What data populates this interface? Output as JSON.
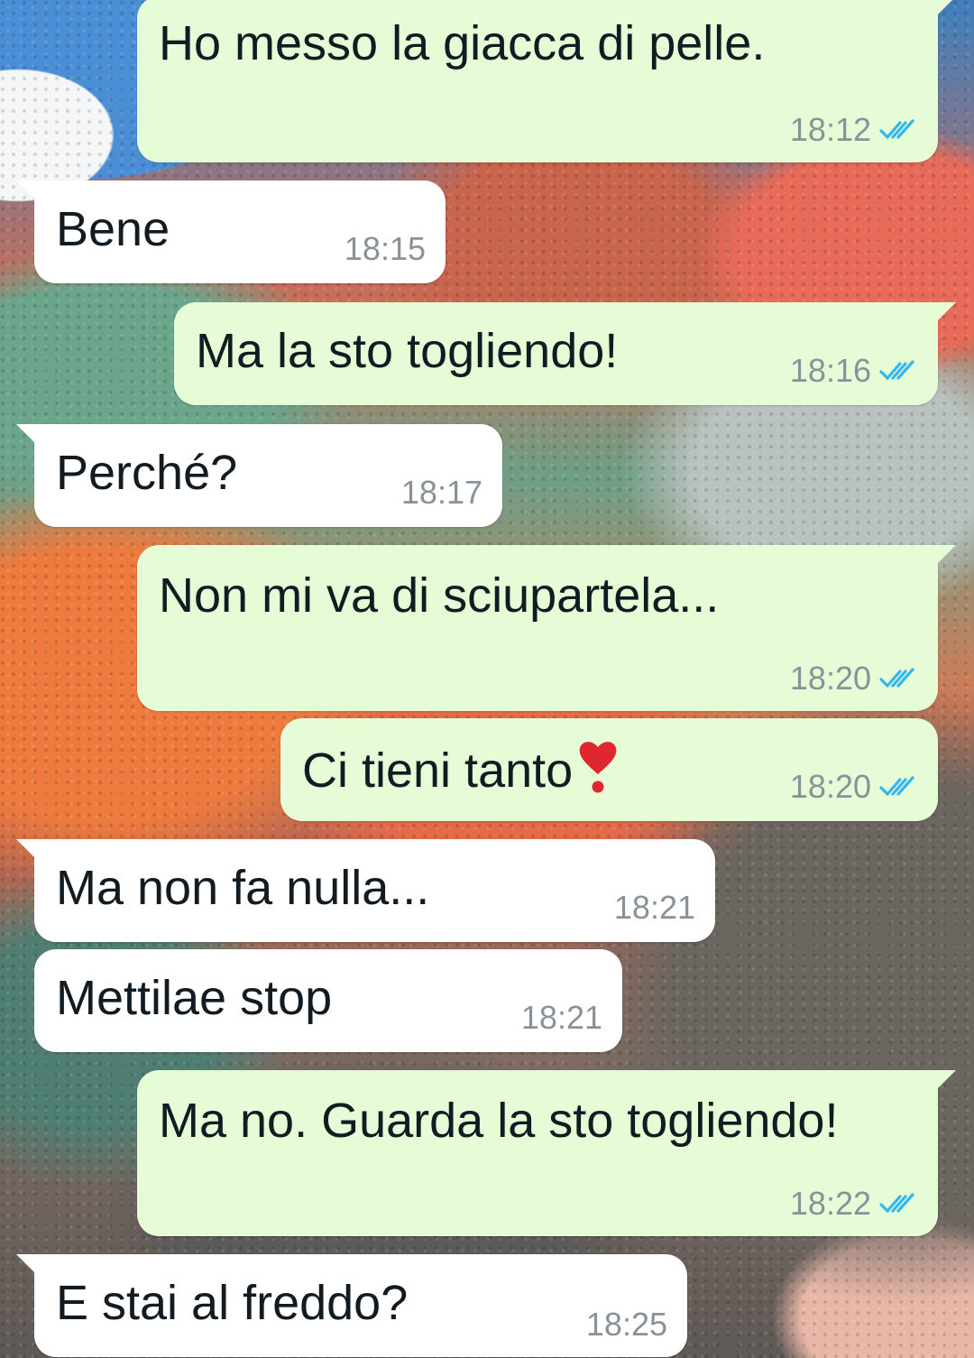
{
  "chat": {
    "messages": [
      {
        "direction": "out",
        "text": "Ho messo la giacca di pelle.",
        "time": "18:12",
        "status": "read"
      },
      {
        "direction": "in",
        "text": "Bene",
        "time": "18:15"
      },
      {
        "direction": "out",
        "text": "Ma la sto togliendo!",
        "time": "18:16",
        "status": "read"
      },
      {
        "direction": "in",
        "text": "Perché?",
        "time": "18:17"
      },
      {
        "direction": "out",
        "text": "Non mi va di sciupartela...",
        "time": "18:20",
        "status": "read"
      },
      {
        "direction": "out",
        "text": "Ci tieni tanto",
        "emoji": "heavy-heart-exclamation",
        "time": "18:20",
        "status": "read"
      },
      {
        "direction": "in",
        "text": "Ma non fa nulla...",
        "time": "18:21"
      },
      {
        "direction": "in",
        "text": "Mettilae stop",
        "time": "18:21"
      },
      {
        "direction": "out",
        "text": "Ma no. Guarda la sto togliendo!",
        "time": "18:22",
        "status": "read"
      },
      {
        "direction": "in",
        "text": "E stai al freddo?",
        "time": "18:25"
      }
    ]
  },
  "colors": {
    "outgoing_bubble": "#e5fcd7",
    "incoming_bubble": "#ffffff",
    "read_ticks": "#34b7f1",
    "timestamp": "#8a9299"
  }
}
